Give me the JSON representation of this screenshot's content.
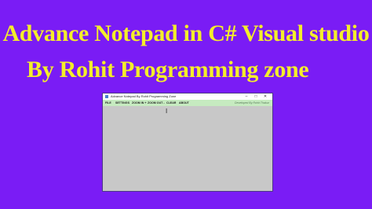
{
  "heading": {
    "line1": "Advance Notepad in C# Visual studio",
    "line2": "By Rohit Programming zone"
  },
  "window": {
    "title": "Advance Notepad By Rohit Programming Zone",
    "controls": {
      "minimize": "–",
      "maximize": "□",
      "close": "✕"
    }
  },
  "menu": {
    "items": [
      {
        "label": "FILE"
      },
      {
        "label": "SETTINGS"
      },
      {
        "label": "ZOOM IN +"
      },
      {
        "label": "ZOOM OUT -"
      },
      {
        "label": "CLEAR"
      },
      {
        "label": "ABOUT"
      }
    ],
    "credit": "Developed By Rohit Thakur"
  },
  "editor": {
    "caret": "I"
  },
  "colors": {
    "background": "#7A1CF5",
    "heading": "#F4EE2A",
    "menubar": "#C6EBC0",
    "editor": "#C8C8C8"
  },
  "icons": {
    "app": "notepad-icon"
  }
}
